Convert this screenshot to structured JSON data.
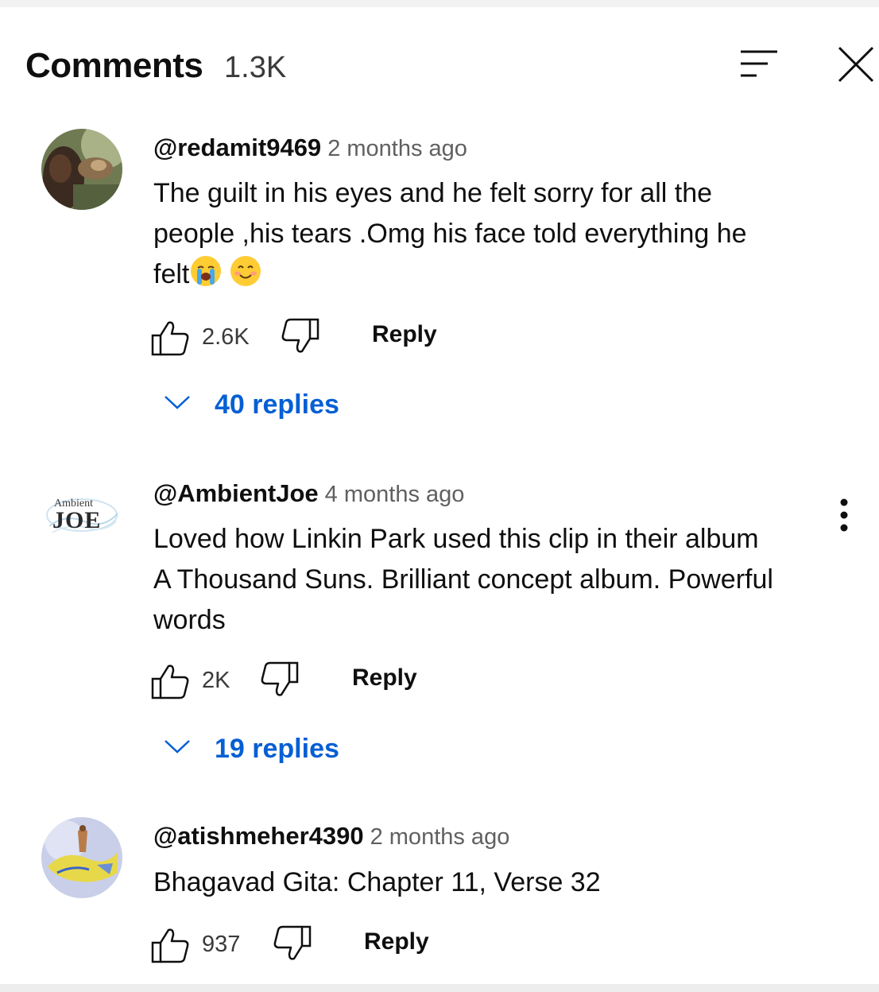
{
  "header": {
    "title": "Comments",
    "count": "1.3K"
  },
  "comments": [
    {
      "handle": "@redamit9469",
      "time": "2 months ago",
      "text_lines": [
        "The guilt in his eyes and he felt sorry for all the",
        "people ,his tears .Omg his face told everything he",
        "felt"
      ],
      "emojis": [
        "loudly-crying-face-emoji",
        "smiling-face-emoji"
      ],
      "likes": "2.6K",
      "reply_label": "Reply",
      "replies_label": "40 replies"
    },
    {
      "handle": "@AmbientJoe",
      "time": "4 months ago",
      "avatar_text_top": "Ambient",
      "avatar_text_bottom": "JOE",
      "text_lines": [
        "Loved how Linkin Park used this clip in their album",
        "A Thousand Suns. Brilliant concept album. Powerful",
        "words"
      ],
      "likes": "2K",
      "reply_label": "Reply",
      "replies_label": "19 replies"
    },
    {
      "handle": "@atishmeher4390",
      "time": "2 months ago",
      "text_lines": [
        "Bhagavad Gita: Chapter 11, Verse 32"
      ],
      "likes": "937",
      "reply_label": "Reply"
    }
  ],
  "icons": {
    "sort": "sort-icon",
    "close": "close-icon",
    "like": "thumbs-up-icon",
    "dislike": "thumbs-down-icon",
    "expand": "chevron-down-icon",
    "more": "more-vert-icon"
  },
  "colors": {
    "link_blue": "#065fd4",
    "text": "#0f0f0f",
    "secondary_text": "#606060"
  }
}
